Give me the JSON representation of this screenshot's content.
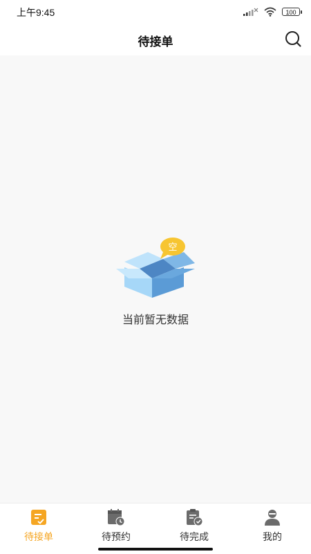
{
  "status_bar": {
    "time": "上午9:45",
    "battery": "100",
    "icons": [
      "signal-icon",
      "wifi-icon",
      "battery-icon"
    ]
  },
  "header": {
    "title": "待接单",
    "search_icon": "search-icon"
  },
  "empty_state": {
    "badge": "空",
    "message": "当前暂无数据",
    "icon": "empty-box-icon"
  },
  "tabs": [
    {
      "label": "待接单",
      "icon": "pending-order-icon",
      "active": true
    },
    {
      "label": "待预约",
      "icon": "calendar-clock-icon",
      "active": false
    },
    {
      "label": "待完成",
      "icon": "clipboard-check-icon",
      "active": false
    },
    {
      "label": "我的",
      "icon": "user-icon",
      "active": false
    }
  ],
  "colors": {
    "accent": "#f5a623",
    "inactive_icon": "#6b6b6b",
    "box_light": "#9fd2f6",
    "box_dark": "#5a9bd8",
    "badge": "#f7c531"
  }
}
